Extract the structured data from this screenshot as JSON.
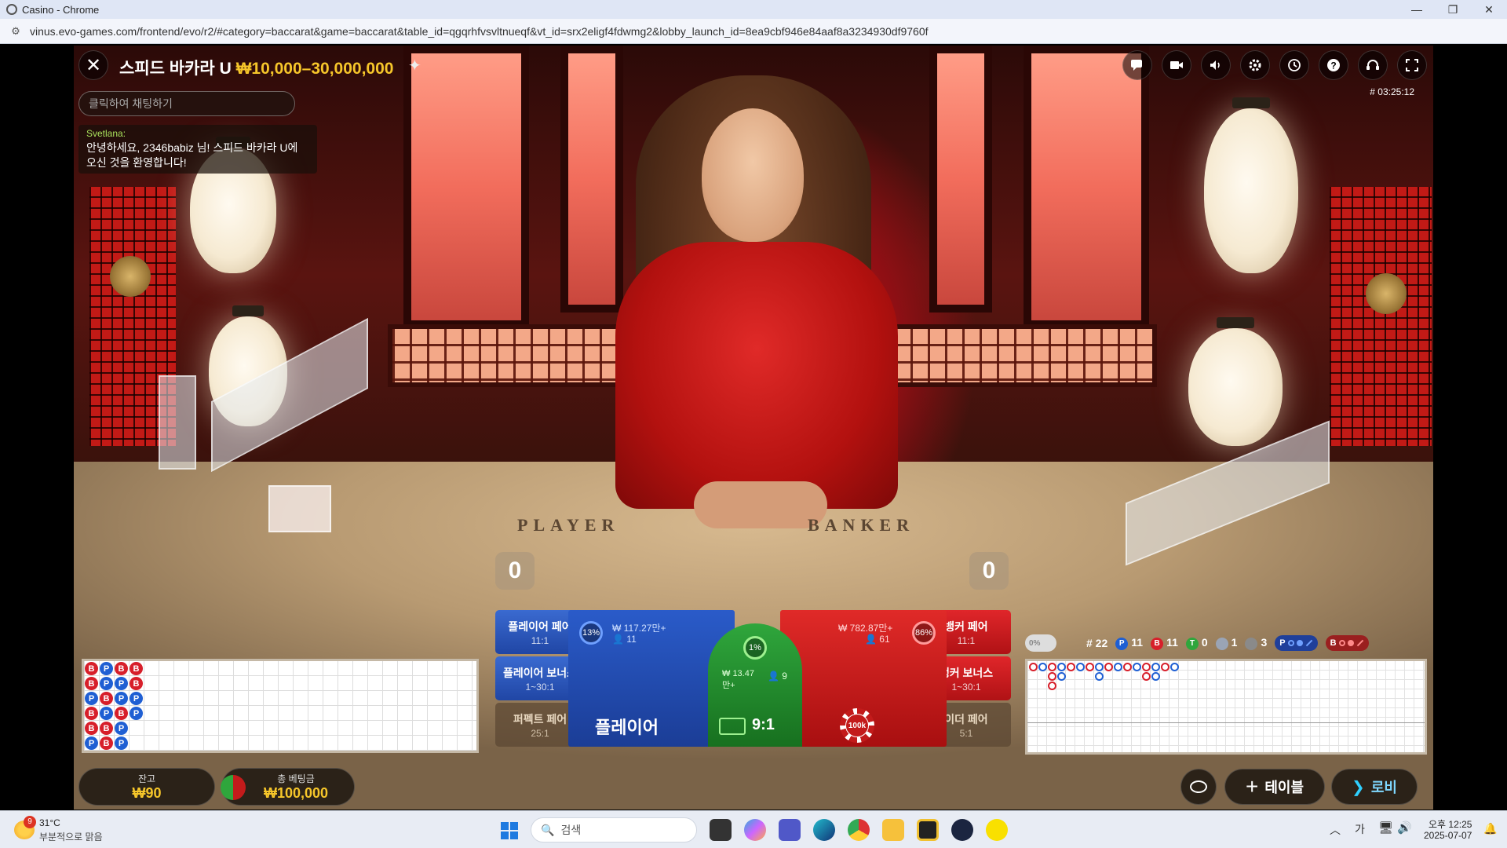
{
  "window": {
    "title": "Casino - Chrome",
    "url": "vinus.evo-games.com/frontend/evo/r2/#category=baccarat&game=baccarat&table_id=qgqrhfvsvltnueqf&vt_id=srx2eligf4fdwmg2&lobby_launch_id=8ea9cbf946e84aaf8a3234930df9760f"
  },
  "header": {
    "table_name": "스피드 바카라 U",
    "limits": "₩10,000–30,000,000",
    "round_id": "# 03:25:12"
  },
  "chat": {
    "placeholder": "클릭하여 채팅하기",
    "user": "Svetlana:",
    "message": "안녕하세요, 2346babiz 님! 스피드 바카라 U에 오신 것을 환영합니다!"
  },
  "table": {
    "player_text": "PLAYER",
    "banker_text": "BANKER",
    "player_score": "0",
    "banker_score": "0"
  },
  "bets": {
    "player_pair": {
      "label": "플레이어 페어",
      "odds": "11:1"
    },
    "player_bonus": {
      "label": "플레이어 보너스",
      "odds": "1~30:1"
    },
    "perfect_pair": {
      "label": "퍼펙트 페어",
      "odds": "25:1"
    },
    "banker_pair": {
      "label": "뱅커 페어",
      "odds": "11:1"
    },
    "banker_bonus": {
      "label": "뱅커 보너스",
      "odds": "1~30:1"
    },
    "either_pair": {
      "label": "이더 페어",
      "odds": "5:1"
    },
    "player": {
      "label": "플레이어",
      "pct": "13%",
      "amount": "₩ 117.27만+",
      "players": "11"
    },
    "banker": {
      "label": "",
      "pct": "86%",
      "amount": "₩ 782.87만+",
      "players": "61"
    },
    "tie": {
      "odds": "9:1",
      "pct": "1%",
      "amount": "₩ 13.47 만+",
      "players": "9"
    },
    "chip": "100k"
  },
  "stats": {
    "pct": "0%",
    "round": "# 22",
    "p_count": "11",
    "b_count": "11",
    "t_count": "0",
    "p_pair": "1",
    "b_pair": "3",
    "p_letter": "P",
    "b_letter": "B",
    "t_letter": "T"
  },
  "bead_road": [
    [
      "B",
      "P",
      "B",
      "B"
    ],
    [
      "B",
      "P",
      "P",
      "B"
    ],
    [
      "P",
      "B",
      "P",
      "P"
    ],
    [
      "B",
      "P",
      "B",
      "P"
    ],
    [
      "B",
      "B",
      "P"
    ],
    [
      "P",
      "B",
      "P"
    ]
  ],
  "footer": {
    "balance_label": "잔고",
    "balance": "₩90",
    "total_bet_label": "총 베팅금",
    "total_bet": "₩100,000",
    "add_table": "테이블",
    "lobby": "로비"
  },
  "taskbar": {
    "temp": "31°C",
    "weather": "부분적으로 맑음",
    "search": "검색",
    "time": "오후 12:25",
    "date": "2025-07-07",
    "ime": "가",
    "badge": "9"
  },
  "colors": {
    "player": "#1f5fd3",
    "banker": "#d71f2a",
    "tie": "#2fa63c",
    "gold": "#f6c62a"
  }
}
